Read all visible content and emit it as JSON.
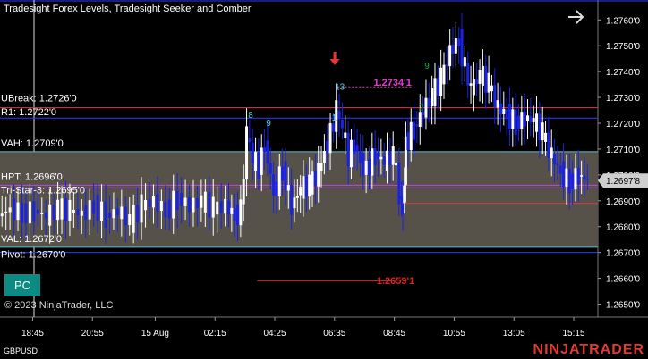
{
  "indicator_title": "Tradesight Forex Levels, Tradesight Seeker and Comber",
  "copyright": "© 2023 NinjaTrader, LLC",
  "symbol": "GBPUSD",
  "brand": "NINJATRADER",
  "pc_button": "PC",
  "icons": {
    "nav": "arrow-right-icon",
    "signal": "arrow-down-icon"
  },
  "colors": {
    "background": "#000000",
    "up_candle": "#ffffff",
    "down_candle": "#1a22e6",
    "value_area_fill": "#56524a",
    "vah_line": "#4fc3e0",
    "val_line": "#4fc3e0",
    "ubreak_line": "#e03a3a",
    "r1_line": "#2a3cff",
    "pivot_line": "#2a3cff",
    "hpt_line": "#b44fd1",
    "magenta_label": "#e23fd0",
    "red_label": "#e02020",
    "seeker_cyan": "#56d7e8",
    "comber_green": "#1aa84a",
    "price_marker": "#cfcfcf"
  },
  "chart_data": {
    "type": "candlestick",
    "y_axis": {
      "range": [
        1.2645,
        1.2767
      ],
      "ticks": [
        "1.2760'0",
        "1.2750'0",
        "1.2740'0",
        "1.2730'0",
        "1.2720'0",
        "1.2710'0",
        "1.2700'0",
        "1.2690'0",
        "1.2680'0",
        "1.2670'0",
        "1.2660'0",
        "1.2650'0"
      ],
      "tick_values": [
        1.276,
        1.275,
        1.274,
        1.273,
        1.272,
        1.271,
        1.27,
        1.269,
        1.268,
        1.267,
        1.266,
        1.265
      ]
    },
    "x_axis": {
      "tick_labels": [
        "18:45",
        "20:55",
        "15 Aug",
        "02:15",
        "04:25",
        "06:35",
        "08:45",
        "10:55",
        "13:05",
        "15:15"
      ],
      "tick_positions": [
        0.11,
        0.21,
        0.315,
        0.415,
        0.515,
        0.615,
        0.715,
        0.815,
        0.915,
        1.015
      ]
    },
    "current_price": {
      "value": 1.26978,
      "label": "1.2697'8"
    },
    "levels": [
      {
        "name": "UBreak",
        "label": "UBreak: 1.2726'0",
        "value": 1.2726,
        "color_key": "ubreak_line"
      },
      {
        "name": "R1",
        "label": "R1: 1.2722'0",
        "value": 1.2722,
        "color_key": "r1_line"
      },
      {
        "name": "VAH",
        "label": "VAH: 1.2709'0",
        "value": 1.2709,
        "color_key": "vah_line"
      },
      {
        "name": "HPT",
        "label": "HPT: 1.2696'0",
        "value": 1.2696,
        "color_key": "hpt_line"
      },
      {
        "name": "Tri-Star",
        "label": "Tri-Star-3: 1.2695'0",
        "value": 1.2695,
        "color_key": "hpt_line"
      },
      {
        "name": "VAL",
        "label": "VAL: 1.2672'0",
        "value": 1.2672,
        "color_key": "val_line"
      },
      {
        "name": "Pivot",
        "label": "Pivot: 1.2670'0",
        "value": 1.267,
        "color_key": "pivot_line"
      }
    ],
    "annotations": [
      {
        "text": "1.2734'1",
        "value": 1.27341,
        "color_key": "magenta_label"
      },
      {
        "text": "1.2659'1",
        "value": 1.26591,
        "color_key": "red_label"
      },
      {
        "text": "1.2689'",
        "value": 1.2689,
        "color_key": "red_label",
        "hidden_text": true
      }
    ],
    "seeker_counts": [
      {
        "text": "8",
        "at": 0.415,
        "value": 1.2722
      },
      {
        "text": "9",
        "at": 0.445,
        "value": 1.2719
      },
      {
        "text": "13",
        "at": 0.56,
        "value": 1.2733
      },
      {
        "text": "1",
        "at": 0.555,
        "value": 1.2721
      }
    ],
    "comber_counts": [
      {
        "text": "9",
        "at": 0.71,
        "value": 1.2741
      },
      {
        "text": "2",
        "at": 0.7,
        "value": 1.2725
      }
    ],
    "series": [
      {
        "name": "GBPUSD",
        "points": [
          [
            0.0,
            1.2684
          ],
          [
            0.02,
            1.2687
          ],
          [
            0.04,
            1.2685
          ],
          [
            0.06,
            1.2686
          ],
          [
            0.08,
            1.2684
          ],
          [
            0.1,
            1.2687
          ],
          [
            0.12,
            1.2686
          ],
          [
            0.14,
            1.2685
          ],
          [
            0.16,
            1.2688
          ],
          [
            0.18,
            1.2684
          ],
          [
            0.2,
            1.2686
          ],
          [
            0.22,
            1.2682
          ],
          [
            0.24,
            1.2688
          ],
          [
            0.26,
            1.269
          ],
          [
            0.28,
            1.2686
          ],
          [
            0.3,
            1.2691
          ],
          [
            0.32,
            1.2688
          ],
          [
            0.34,
            1.269
          ],
          [
            0.36,
            1.2687
          ],
          [
            0.38,
            1.2688
          ],
          [
            0.395,
            1.2684
          ],
          [
            0.405,
            1.2686
          ],
          [
            0.415,
            1.2716
          ],
          [
            0.425,
            1.2706
          ],
          [
            0.435,
            1.2703
          ],
          [
            0.445,
            1.2712
          ],
          [
            0.46,
            1.2693
          ],
          [
            0.475,
            1.2702
          ],
          [
            0.49,
            1.2688
          ],
          [
            0.505,
            1.2695
          ],
          [
            0.52,
            1.2696
          ],
          [
            0.535,
            1.2701
          ],
          [
            0.545,
            1.2709
          ],
          [
            0.555,
            1.2716
          ],
          [
            0.565,
            1.2725
          ],
          [
            0.575,
            1.2718
          ],
          [
            0.585,
            1.2707
          ],
          [
            0.595,
            1.2712
          ],
          [
            0.605,
            1.2705
          ],
          [
            0.615,
            1.2702
          ],
          [
            0.63,
            1.2708
          ],
          [
            0.645,
            1.2705
          ],
          [
            0.66,
            1.2708
          ],
          [
            0.67,
            1.2693
          ],
          [
            0.675,
            1.2686
          ],
          [
            0.68,
            1.2712
          ],
          [
            0.695,
            1.2718
          ],
          [
            0.71,
            1.2725
          ],
          [
            0.725,
            1.2731
          ],
          [
            0.74,
            1.2737
          ],
          [
            0.755,
            1.2748
          ],
          [
            0.77,
            1.2752
          ],
          [
            0.78,
            1.2741
          ],
          [
            0.79,
            1.2733
          ],
          [
            0.805,
            1.2739
          ],
          [
            0.82,
            1.2735
          ],
          [
            0.835,
            1.2726
          ],
          [
            0.85,
            1.2723
          ],
          [
            0.865,
            1.272
          ],
          [
            0.88,
            1.2722
          ],
          [
            0.895,
            1.2721
          ],
          [
            0.91,
            1.2716
          ],
          [
            0.925,
            1.2707
          ],
          [
            0.94,
            1.2701
          ],
          [
            0.955,
            1.2697
          ],
          [
            0.97,
            1.27
          ],
          [
            0.985,
            1.2698
          ]
        ]
      }
    ]
  }
}
